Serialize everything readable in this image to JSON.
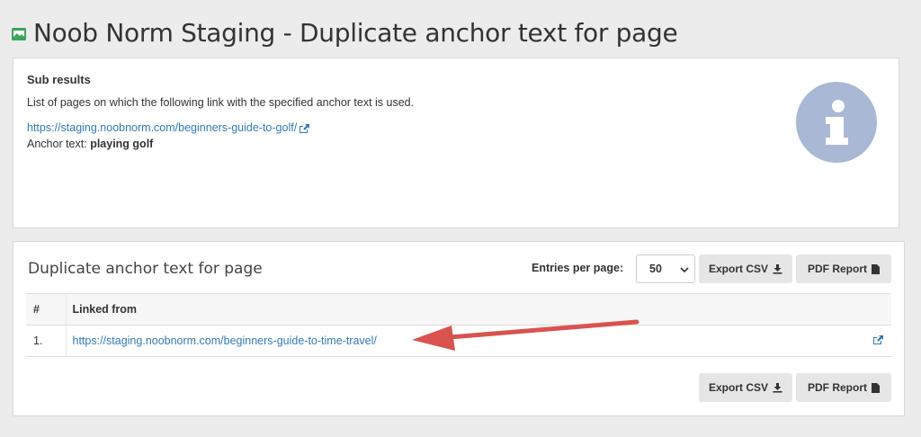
{
  "header": {
    "title": "Noob Norm Staging - Duplicate anchor text for page",
    "site_icon": "site-monitor-icon"
  },
  "sub_results": {
    "title": "Sub results",
    "description": "List of pages on which the following link with the specified anchor text is used.",
    "link": "https://staging.noobnorm.com/beginners-guide-to-golf/",
    "anchor_label": "Anchor text:",
    "anchor_value": "playing golf",
    "info_icon": "info-icon"
  },
  "table_panel": {
    "title": "Duplicate anchor text for page",
    "entries_label": "Entries per page:",
    "entries_value": "50",
    "export_csv_label": "Export CSV",
    "pdf_report_label": "PDF Report",
    "columns": [
      "#",
      "Linked from"
    ],
    "rows": [
      {
        "num": "1.",
        "url": "https://staging.noobnorm.com/beginners-guide-to-time-travel/"
      }
    ]
  },
  "colors": {
    "link": "#337ab7",
    "info_circle": "#a9b8d4",
    "arrow": "#d9534f",
    "site_icon": "#3aa55b"
  }
}
